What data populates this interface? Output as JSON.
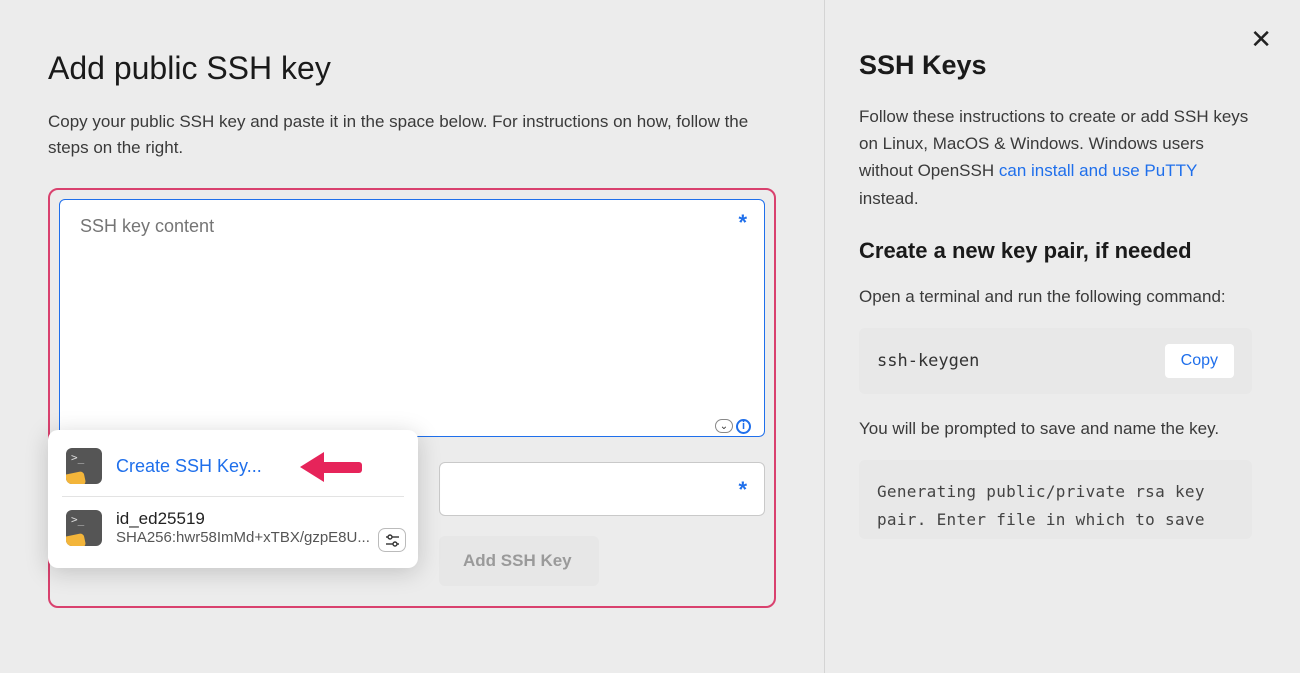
{
  "left": {
    "title": "Add public SSH key",
    "subtitle": "Copy your public SSH key and paste it in the space below. For instructions on how, follow the steps on the right.",
    "textarea_placeholder": "SSH key content",
    "add_button_label": "Add SSH Key"
  },
  "autofill": {
    "create_label": "Create SSH Key...",
    "saved_key_name": "id_ed25519",
    "saved_key_fingerprint": "SHA256:hwr58ImMd+xTBX/gzpE8U..."
  },
  "right": {
    "title": "SSH Keys",
    "desc_prefix": "Follow these instructions to create or add SSH keys on Linux, MacOS & Windows. Windows users without OpenSSH ",
    "desc_link": "can install and use PuTTY",
    "desc_suffix": " instead.",
    "subheading": "Create a new key pair, if needed",
    "step1": "Open a terminal and run the following command:",
    "command": "ssh-keygen",
    "copy_label": "Copy",
    "step2": "You will be prompted to save and name the key.",
    "output": "Generating public/private rsa key pair. Enter file in which to save"
  }
}
